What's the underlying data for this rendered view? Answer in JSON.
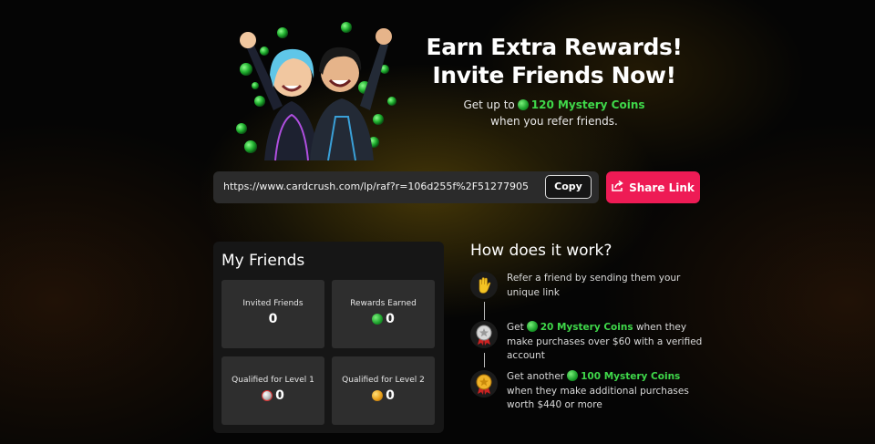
{
  "hero": {
    "title_line1": "Earn Extra Rewards!",
    "title_line2": "Invite Friends Now!",
    "sub_prefix": "Get up to",
    "sub_amount": "120 Mystery Coins",
    "sub_suffix": "when you refer friends."
  },
  "referral": {
    "link": "https://www.cardcrush.com/lp/raf?r=106d255f%2F51277905",
    "copy_label": "Copy",
    "share_label": "Share Link"
  },
  "friends": {
    "title": "My Friends",
    "cards": [
      {
        "label": "Invited Friends",
        "value": "0"
      },
      {
        "label": "Rewards Earned",
        "value": "0"
      },
      {
        "label": "Qualified for Level 1",
        "value": "0"
      },
      {
        "label": "Qualified for Level 2",
        "value": "0"
      }
    ]
  },
  "how": {
    "title": "How does it work?",
    "steps": [
      {
        "icon": "waving-hand-icon",
        "text": "Refer a friend by sending them your unique link"
      },
      {
        "icon": "silver-medal-icon",
        "pre": "Get",
        "amount": "20 Mystery Coins",
        "post": "when they make purchases over $60 with a verified account"
      },
      {
        "icon": "gold-medal-icon",
        "pre": "Get another",
        "amount": "100 Mystery Coins",
        "post": "when they make additional purchases worth $440 or more"
      }
    ]
  },
  "colors": {
    "accent_pink": "#ee1b55",
    "coin_green": "#3fd84a",
    "panel": "#161616",
    "card": "#2e2e2e"
  }
}
